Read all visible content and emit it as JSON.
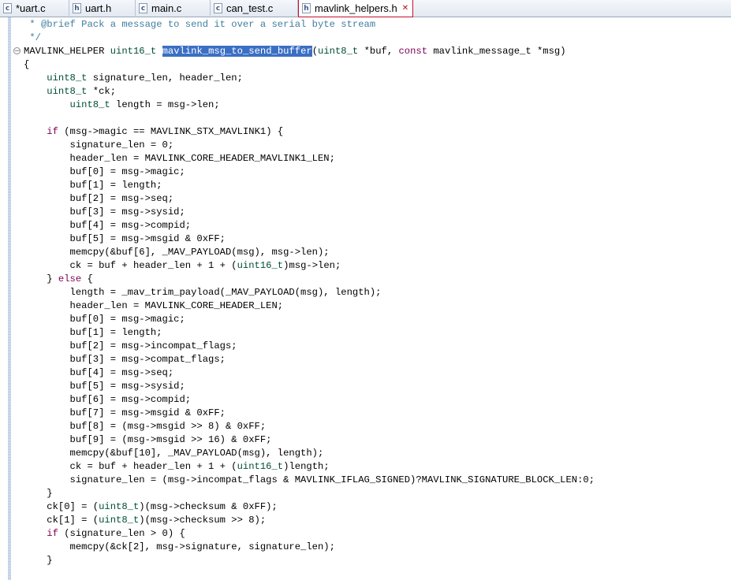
{
  "tabs": [
    {
      "icon": "c",
      "label": "*uart.c",
      "active": false
    },
    {
      "icon": "h",
      "label": "uart.h",
      "active": false
    },
    {
      "icon": "c",
      "label": "main.c",
      "active": false
    },
    {
      "icon": "c",
      "label": "can_test.c",
      "active": false
    },
    {
      "icon": "h",
      "label": "mavlink_helpers.h",
      "active": true
    }
  ],
  "editor": {
    "lines": [
      [
        {
          "c": "cm",
          "t": " * @brief Pack a message to send it over a serial byte stream"
        }
      ],
      [
        {
          "c": "cm",
          "t": " */"
        }
      ],
      [
        {
          "t": "MAVLINK_HELPER "
        },
        {
          "c": "ty",
          "t": "uint16_t"
        },
        {
          "t": " "
        },
        {
          "c": "sel",
          "t": "mavlink_msg_to_send_buffer"
        },
        {
          "t": "("
        },
        {
          "c": "ty",
          "t": "uint8_t"
        },
        {
          "t": " *buf, "
        },
        {
          "c": "kw",
          "t": "const"
        },
        {
          "t": " mavlink_message_t *msg)"
        }
      ],
      [
        {
          "t": "{"
        }
      ],
      [
        {
          "t": "    "
        },
        {
          "c": "ty",
          "t": "uint8_t"
        },
        {
          "t": " signature_len, header_len;"
        }
      ],
      [
        {
          "t": "    "
        },
        {
          "c": "ty",
          "t": "uint8_t"
        },
        {
          "t": " *ck;"
        }
      ],
      [
        {
          "t": "        "
        },
        {
          "c": "ty",
          "t": "uint8_t"
        },
        {
          "t": " length = msg->len;"
        }
      ],
      [
        {
          "t": ""
        }
      ],
      [
        {
          "t": "    "
        },
        {
          "c": "kw",
          "t": "if"
        },
        {
          "t": " (msg->magic == MAVLINK_STX_MAVLINK1) {"
        }
      ],
      [
        {
          "t": "        signature_len = 0;"
        }
      ],
      [
        {
          "t": "        header_len = MAVLINK_CORE_HEADER_MAVLINK1_LEN;"
        }
      ],
      [
        {
          "t": "        buf[0] = msg->magic;"
        }
      ],
      [
        {
          "t": "        buf[1] = length;"
        }
      ],
      [
        {
          "t": "        buf[2] = msg->seq;"
        }
      ],
      [
        {
          "t": "        buf[3] = msg->sysid;"
        }
      ],
      [
        {
          "t": "        buf[4] = msg->compid;"
        }
      ],
      [
        {
          "t": "        buf[5] = msg->msgid & 0xFF;"
        }
      ],
      [
        {
          "t": "        memcpy(&buf[6], _MAV_PAYLOAD(msg), msg->len);"
        }
      ],
      [
        {
          "t": "        ck = buf + header_len + 1 + ("
        },
        {
          "c": "ty",
          "t": "uint16_t"
        },
        {
          "t": ")msg->len;"
        }
      ],
      [
        {
          "t": "    } "
        },
        {
          "c": "kw",
          "t": "else"
        },
        {
          "t": " {"
        }
      ],
      [
        {
          "t": "        length = _mav_trim_payload(_MAV_PAYLOAD(msg), length);"
        }
      ],
      [
        {
          "t": "        header_len = MAVLINK_CORE_HEADER_LEN;"
        }
      ],
      [
        {
          "t": "        buf[0] = msg->magic;"
        }
      ],
      [
        {
          "t": "        buf[1] = length;"
        }
      ],
      [
        {
          "t": "        buf[2] = msg->incompat_flags;"
        }
      ],
      [
        {
          "t": "        buf[3] = msg->compat_flags;"
        }
      ],
      [
        {
          "t": "        buf[4] = msg->seq;"
        }
      ],
      [
        {
          "t": "        buf[5] = msg->sysid;"
        }
      ],
      [
        {
          "t": "        buf[6] = msg->compid;"
        }
      ],
      [
        {
          "t": "        buf[7] = msg->msgid & 0xFF;"
        }
      ],
      [
        {
          "t": "        buf[8] = (msg->msgid >> 8) & 0xFF;"
        }
      ],
      [
        {
          "t": "        buf[9] = (msg->msgid >> 16) & 0xFF;"
        }
      ],
      [
        {
          "t": "        memcpy(&buf[10], _MAV_PAYLOAD(msg), length);"
        }
      ],
      [
        {
          "t": "        ck = buf + header_len + 1 + ("
        },
        {
          "c": "ty",
          "t": "uint16_t"
        },
        {
          "t": ")length;"
        }
      ],
      [
        {
          "t": "        signature_len = (msg->incompat_flags & MAVLINK_IFLAG_SIGNED)?MAVLINK_SIGNATURE_BLOCK_LEN:0;"
        }
      ],
      [
        {
          "t": "    }"
        }
      ],
      [
        {
          "t": "    ck[0] = ("
        },
        {
          "c": "ty",
          "t": "uint8_t"
        },
        {
          "t": ")(msg->checksum & 0xFF);"
        }
      ],
      [
        {
          "t": "    ck[1] = ("
        },
        {
          "c": "ty",
          "t": "uint8_t"
        },
        {
          "t": ")(msg->checksum >> 8);"
        }
      ],
      [
        {
          "t": "    "
        },
        {
          "c": "kw",
          "t": "if"
        },
        {
          "t": " (signature_len > 0) {"
        }
      ],
      [
        {
          "t": "        memcpy(&ck[2], msg->signature, signature_len);"
        }
      ],
      [
        {
          "t": "    }"
        }
      ]
    ]
  },
  "colors": {
    "keyword": "#7f0055",
    "type": "#005032",
    "comment": "#3f7f9f",
    "selection": "#3b6fc4",
    "active_tab_border": "#c8102e"
  }
}
